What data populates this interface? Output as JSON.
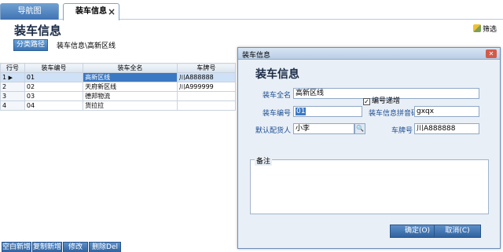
{
  "tabs": [
    {
      "label": "导航图"
    },
    {
      "label": "装车信息",
      "close": "×"
    }
  ],
  "page": {
    "title": "装车信息",
    "filter_label": "筛选",
    "category_button": "分类路径",
    "breadcrumb": "装车信息\\高新区线"
  },
  "grid": {
    "columns": [
      "行号",
      "装车编号",
      "装车全名",
      "车牌号"
    ],
    "rows": [
      {
        "row": "1",
        "code": "01",
        "name": "高新区线",
        "plate": "川A888888"
      },
      {
        "row": "2",
        "code": "02",
        "name": "天府新区线",
        "plate": "川A999999"
      },
      {
        "row": "3",
        "code": "03",
        "name": "德邦物流",
        "plate": ""
      },
      {
        "row": "4",
        "code": "04",
        "name": "货拉拉",
        "plate": ""
      }
    ]
  },
  "toolbar": {
    "new_blank": "空白新增",
    "copy_new": "复制新增",
    "edit": "修改",
    "delete": "删除Del"
  },
  "dialog": {
    "window_title": "装车信息",
    "heading": "装车信息",
    "full_name_label": "装车全名",
    "full_name_value": "高新区线",
    "code_label": "装车编号",
    "code_value": "01",
    "pinyin_label": "装车信息拼音码",
    "pinyin_value": "gxqx",
    "delivery_label": "默认配货人",
    "delivery_value": "小李",
    "plate_label": "车牌号",
    "plate_value": "川A888888",
    "increment_checked": "✓",
    "increment_label": "编号递增",
    "remark_label": "备注",
    "ok_button": "确定(O)",
    "cancel_button": "取消(C)"
  }
}
